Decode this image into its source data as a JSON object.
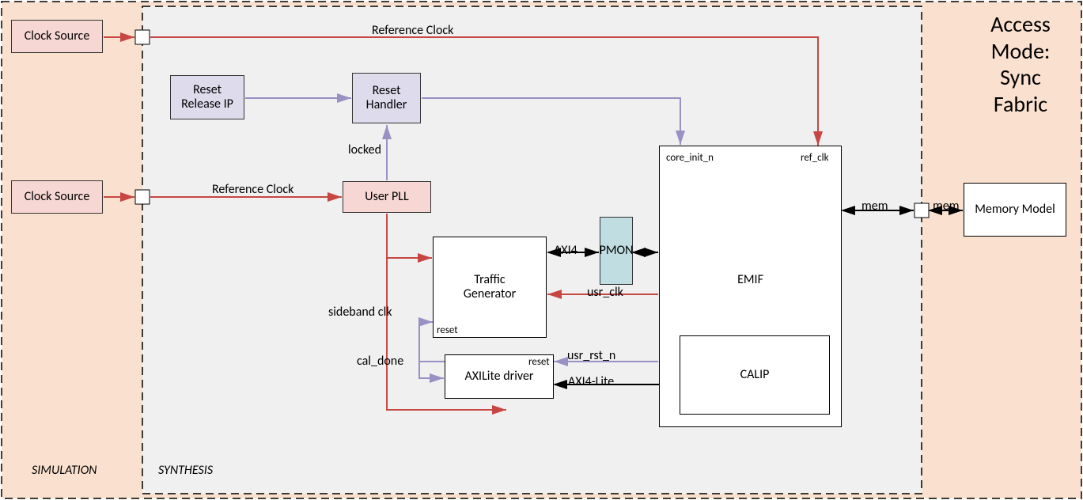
{
  "title_lines": {
    "l1": "Access",
    "l2": "Mode:",
    "l3": "Sync",
    "l4": "Fabric"
  },
  "regions": {
    "simulation": "SIMULATION",
    "synthesis": "SYNTHESIS"
  },
  "blocks": {
    "clock_source_top": "Clock Source",
    "clock_source_bot": "Clock Source",
    "reset_release_ip": "Reset\nRelease IP",
    "reset_handler": "Reset\nHandler",
    "user_pll": "User PLL",
    "traffic_gen": "Traffic\nGenerator",
    "axilite_driver": "AXILite driver",
    "pmon": "PMON",
    "emif": "EMIF",
    "calip": "CALIP",
    "memory_model": "Memory Model"
  },
  "signals": {
    "reference_clock_top": "Reference Clock",
    "reference_clock_bot": "Reference Clock",
    "locked": "locked",
    "sideband_clk": "sideband clk",
    "cal_done": "cal_done",
    "reset_tg": "reset",
    "reset_axl": "reset",
    "axi4": "AXI4",
    "usr_clk": "usr_clk",
    "usr_rst_n": "usr_rst_n",
    "axi4_lite": "AXI4-Lite",
    "core_init_n": "core_init_n",
    "ref_clk": "ref_clk",
    "mem_a": "mem",
    "mem_b": "mem"
  },
  "colors": {
    "sim_bg": "#fae1cf",
    "syn_bg": "#f0f0f0",
    "red": "#c74642",
    "purple": "#9990c4",
    "black": "#000000"
  }
}
